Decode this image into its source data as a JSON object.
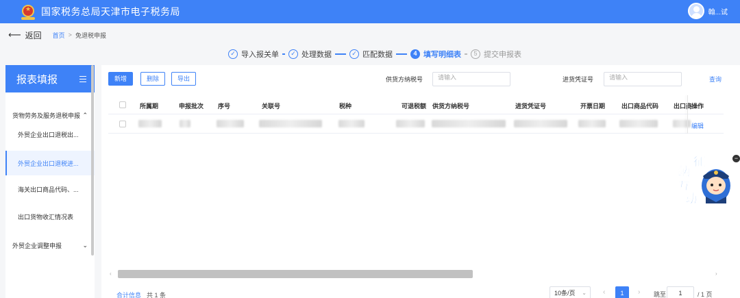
{
  "header": {
    "site_title": "国家税务总局天津市电子税务局",
    "username": "翰...试"
  },
  "breadcrumb": {
    "back_label": "返回",
    "home": "首页",
    "separator": ">",
    "current": "免退税申报"
  },
  "steps": [
    {
      "number": "✓",
      "label": "导入报关单",
      "state": "done"
    },
    {
      "number": "✓",
      "label": "处理数据",
      "state": "done"
    },
    {
      "number": "✓",
      "label": "匹配数据",
      "state": "done"
    },
    {
      "number": "4",
      "label": "填写明细表",
      "state": "active"
    },
    {
      "number": "5",
      "label": "提交申报表",
      "state": "pending"
    }
  ],
  "sidebar": {
    "title": "报表填报",
    "groups": [
      {
        "label": "货物劳务及服务退税申报",
        "expanded": true
      },
      {
        "label": "外贸企业调整申报",
        "expanded": false
      }
    ],
    "items": [
      {
        "label": "外贸企业出口退税出..."
      },
      {
        "label": "外贸企业出口退税进..."
      },
      {
        "label": "海关出口商品代码、..."
      },
      {
        "label": "出口货物收汇情况表"
      }
    ]
  },
  "toolbar": {
    "add_label": "新增",
    "delete_label": "删除",
    "export_label": "导出",
    "supplier_tax_label": "供货方纳税号",
    "supplier_tax_placeholder": "请输入",
    "voucher_label": "进货凭证号",
    "voucher_placeholder": "请输入",
    "query_label": "查询"
  },
  "table": {
    "columns": [
      "所属期",
      "申报批次",
      "序号",
      "关联号",
      "税种",
      "可退税额",
      "供货方纳税号",
      "进货凭证号",
      "开票日期",
      "出口商品代码",
      "出口商",
      "操作"
    ],
    "row_action": "编辑"
  },
  "footer": {
    "summary_link": "合计信息",
    "count_text": "共 1 条",
    "page_size": "10条/页",
    "current_page": "1",
    "jump_label": "跳至",
    "jump_value": "1",
    "total_pages": "/ 1 页"
  },
  "mascot": {
    "chars": [
      "征",
      "纳",
      "互",
      "动"
    ]
  },
  "colors": {
    "primary": "#3e82f7",
    "header_bg": "#3e82f7"
  }
}
